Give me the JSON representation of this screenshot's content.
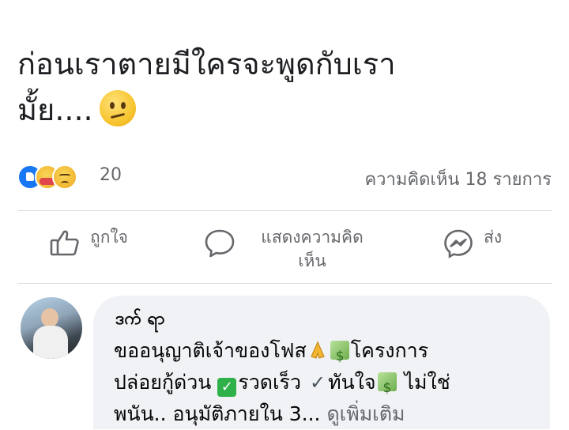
{
  "post": {
    "line1": "ก่อนเราตายมีใครจะพูดกับเรา",
    "line2": "มั้ย....",
    "emoji": "confused-face-icon"
  },
  "stats": {
    "reaction_count": "20",
    "comments_label": "ความคิดเห็น 18 รายการ",
    "reaction_icons": [
      "like-icon",
      "care-icon",
      "sad-icon"
    ]
  },
  "actions": {
    "like": "ถูกใจ",
    "comment_line1": "แสดงความคิด",
    "comment_line2": "เห็น",
    "share": "ส่ง"
  },
  "comment": {
    "author": "ဒက် ရာ",
    "line1_a": "ขออนุญาติเจ้าของโฟส",
    "line1_b": "โครงการ",
    "line2_a": "ปล่อยกู้ด่วน",
    "line2_b": "รวดเร็ว",
    "line2_c": "ทันใจ",
    "line2_d": "ไม่ใช่",
    "line3_a": "พนัน.. อนุมัติภายใน 3...",
    "see_more": "ดูเพิ่มเติม"
  },
  "colors": {
    "like_blue": "#1877f2",
    "muted_text": "#65676b",
    "bubble_bg": "#f0f2f5"
  }
}
